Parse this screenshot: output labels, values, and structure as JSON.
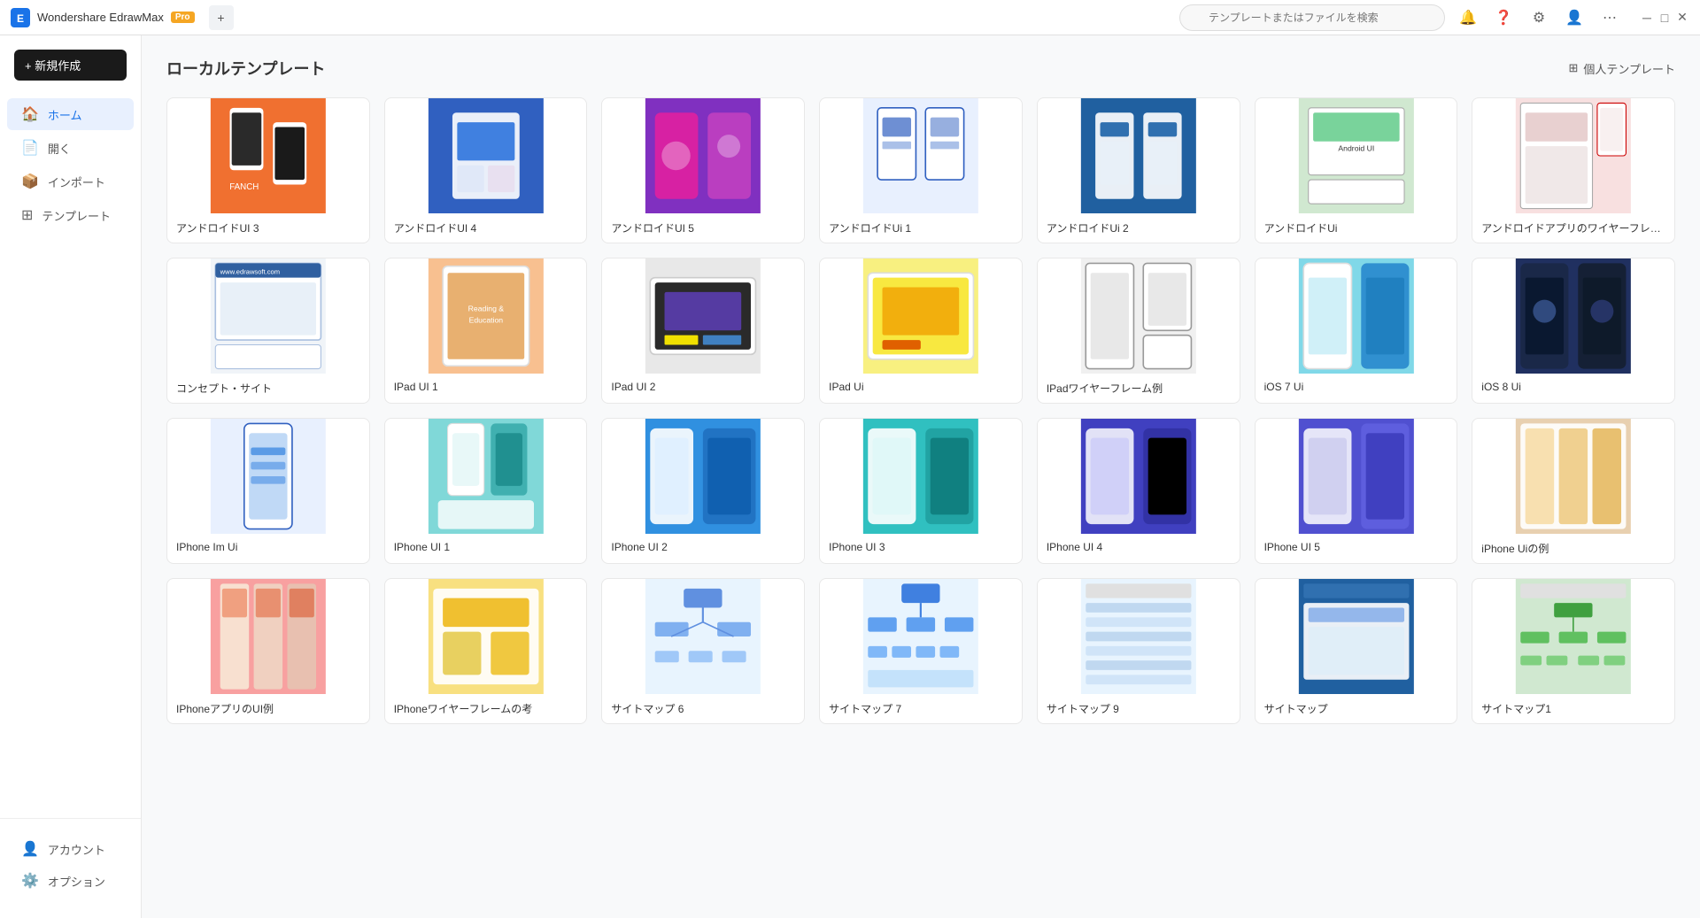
{
  "titleBar": {
    "appName": "Wondershare EdrawMax",
    "proBadge": "Pro",
    "newButtonLabel": "+ 新規作成",
    "searchPlaceholder": "テンプレートまたはファイルを検索",
    "addTabLabel": "+"
  },
  "sidebar": {
    "items": [
      {
        "id": "home",
        "label": "ホーム",
        "icon": "🏠",
        "active": true
      },
      {
        "id": "open",
        "label": "開く",
        "icon": "📄"
      },
      {
        "id": "import",
        "label": "インポート",
        "icon": "📦"
      },
      {
        "id": "template",
        "label": "テンプレート",
        "icon": "⊞"
      }
    ],
    "bottomItems": [
      {
        "id": "account",
        "label": "アカウント",
        "icon": "👤"
      },
      {
        "id": "options",
        "label": "オプション",
        "icon": "⚙️"
      }
    ]
  },
  "content": {
    "sectionTitle": "ローカルテンプレート",
    "personalTemplatesLabel": "個人テンプレート",
    "templates": [
      {
        "id": 1,
        "label": "アンドロイドUI 3",
        "thumbClass": "thumb-orange",
        "row": 1
      },
      {
        "id": 2,
        "label": "アンドロイドUI 4",
        "thumbClass": "thumb-blue",
        "row": 1
      },
      {
        "id": 3,
        "label": "アンドロイドUI 5",
        "thumbClass": "thumb-purple",
        "row": 1
      },
      {
        "id": 4,
        "label": "アンドロイドUi 1",
        "thumbClass": "thumb-light-blue",
        "row": 1
      },
      {
        "id": 5,
        "label": "アンドロイドUi 2",
        "thumbClass": "thumb-blue2",
        "row": 1
      },
      {
        "id": 6,
        "label": "アンドロイドUi",
        "thumbClass": "thumb-green",
        "row": 1
      },
      {
        "id": 7,
        "label": "アンドロイドアプリのワイヤーフレーム",
        "thumbClass": "thumb-red",
        "row": 1
      },
      {
        "id": 8,
        "label": "コンセプト・サイト",
        "thumbClass": "thumb-white",
        "row": 2
      },
      {
        "id": 9,
        "label": "IPad UI 1",
        "thumbClass": "thumb-peach",
        "row": 2
      },
      {
        "id": 10,
        "label": "IPad UI 2",
        "thumbClass": "thumb-light",
        "row": 2
      },
      {
        "id": 11,
        "label": "IPad Ui",
        "thumbClass": "thumb-yellow",
        "row": 2
      },
      {
        "id": 12,
        "label": "IPadワイヤーフレーム例",
        "thumbClass": "thumb-light",
        "row": 2
      },
      {
        "id": 13,
        "label": "iOS 7 Ui",
        "thumbClass": "thumb-cyan",
        "row": 2
      },
      {
        "id": 14,
        "label": "iOS 8 Ui",
        "thumbClass": "thumb-dark",
        "row": 2
      },
      {
        "id": 15,
        "label": "IPhone Im Ui",
        "thumbClass": "thumb-light-blue",
        "row": 3
      },
      {
        "id": 16,
        "label": "IPhone UI 1",
        "thumbClass": "thumb-teal",
        "row": 3
      },
      {
        "id": 17,
        "label": "IPhone UI 2",
        "thumbClass": "thumb-blue3",
        "row": 3
      },
      {
        "id": 18,
        "label": "IPhone UI 3",
        "thumbClass": "thumb-teal",
        "row": 3
      },
      {
        "id": 19,
        "label": "IPhone UI 4",
        "thumbClass": "thumb-indigo",
        "row": 3
      },
      {
        "id": 20,
        "label": "IPhone UI 5",
        "thumbClass": "thumb-indigo2",
        "row": 3
      },
      {
        "id": 21,
        "label": "iPhone Uiの例",
        "thumbClass": "thumb-tan",
        "row": 3
      },
      {
        "id": 22,
        "label": "IPhoneアプリのUI例",
        "thumbClass": "thumb-pink",
        "row": 4
      },
      {
        "id": 23,
        "label": "IPhoneワイヤーフレームの考",
        "thumbClass": "thumb-yellow",
        "row": 4
      },
      {
        "id": 24,
        "label": "サイトマップ 6",
        "thumbClass": "thumb-sitemap",
        "row": 4
      },
      {
        "id": 25,
        "label": "サイトマップ 7",
        "thumbClass": "thumb-sitemap",
        "row": 4
      },
      {
        "id": 26,
        "label": "サイトマップ 9",
        "thumbClass": "thumb-sitemap",
        "row": 4
      },
      {
        "id": 27,
        "label": "サイトマップ",
        "thumbClass": "thumb-blue2",
        "row": 4
      },
      {
        "id": 28,
        "label": "サイトマップ1",
        "thumbClass": "thumb-green2",
        "row": 4
      }
    ]
  }
}
